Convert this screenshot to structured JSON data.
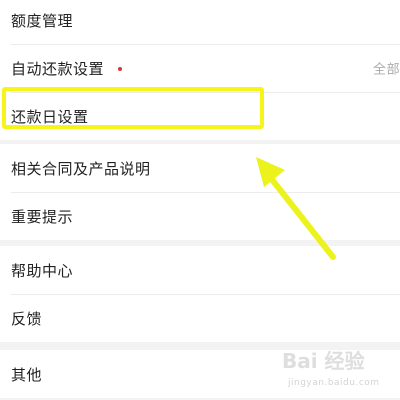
{
  "colors": {
    "highlight": "#f5f51a",
    "arrow": "#ecf21c",
    "dot": "#e0303a"
  },
  "groups": [
    {
      "items": [
        {
          "label": "额度管理"
        },
        {
          "label": "自动还款设置",
          "trailing": "全部"
        },
        {
          "label": "还款日设置"
        }
      ]
    },
    {
      "items": [
        {
          "label": "相关合同及产品说明"
        },
        {
          "label": "重要提示"
        }
      ]
    },
    {
      "items": [
        {
          "label": "帮助中心"
        },
        {
          "label": "反馈"
        }
      ]
    },
    {
      "items": [
        {
          "label": "其他"
        }
      ]
    }
  ],
  "watermark": {
    "brand": "Bai 经验",
    "url": "jingyan.baidu.com"
  }
}
